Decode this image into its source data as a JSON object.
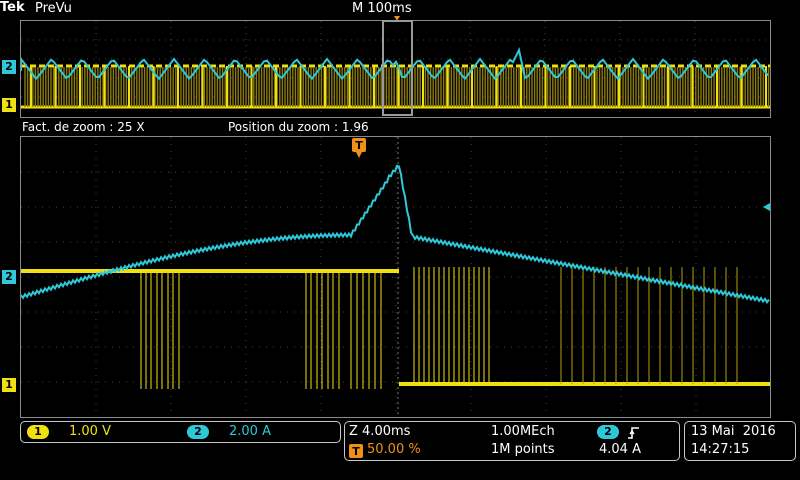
{
  "header": {
    "brand": "Tek",
    "mode": "PreVu",
    "timebase": "M 100ms"
  },
  "zoom_info": {
    "factor": "Fact. de zoom : 25 X",
    "position": "Position du zoom  : 1.96"
  },
  "markers": {
    "trigger": "T",
    "ch1": "1",
    "ch2": "2"
  },
  "channels": {
    "ch1": {
      "badge": "1",
      "scale": "1.00 V",
      "color": "#f0e010"
    },
    "ch2": {
      "badge": "2",
      "scale": "2.00 A",
      "color": "#2fc8d8"
    }
  },
  "acquisition": {
    "zoom_time": "Z 4.00ms",
    "trigger_pos": "50.00 %",
    "sample_rate": "1.00MEch",
    "record_length": "1M points",
    "trigger_source": "2",
    "trigger_slope_icon": "rising-edge-icon",
    "trigger_level": "4.04 A"
  },
  "datetime": {
    "date": "13 Mai  2016",
    "time": "14:27:15"
  },
  "colors": {
    "ch1": "#f0e010",
    "ch2": "#2fc8d8",
    "trigger": "#f09018"
  }
}
